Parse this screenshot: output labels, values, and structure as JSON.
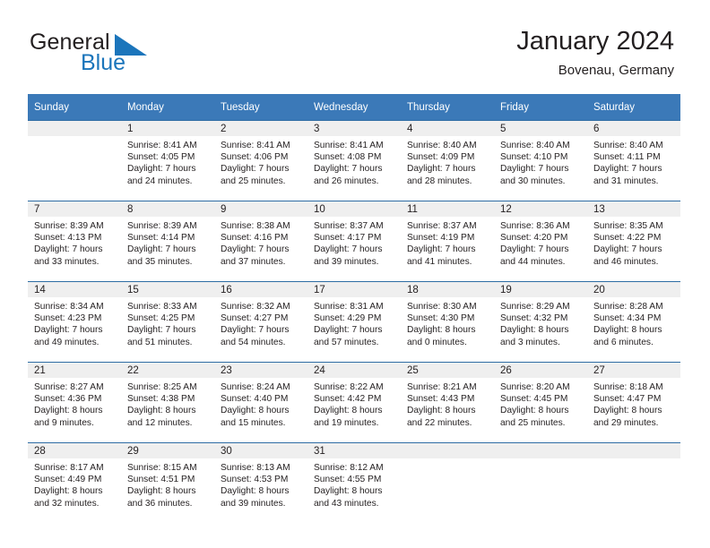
{
  "brand": {
    "name_part1": "General",
    "name_part2": "Blue",
    "mark_icon": "blue-triangle-logo-icon",
    "color_primary": "#1b75bb",
    "color_text": "#231f20"
  },
  "header": {
    "title": "January 2024",
    "subtitle": "Bovenau, Germany"
  },
  "theme": {
    "header_row_bg": "#3b79b8",
    "row_divider": "#2e6da4",
    "daynum_band_bg": "#efefef",
    "cell_bg": "#ffffff"
  },
  "calendar": {
    "weekday_headers": [
      "Sunday",
      "Monday",
      "Tuesday",
      "Wednesday",
      "Thursday",
      "Friday",
      "Saturday"
    ],
    "weeks": [
      [
        {
          "day": "",
          "empty": true,
          "sunrise": "",
          "sunset": "",
          "daylight1": "",
          "daylight2": ""
        },
        {
          "day": "1",
          "sunrise": "Sunrise: 8:41 AM",
          "sunset": "Sunset: 4:05 PM",
          "daylight1": "Daylight: 7 hours",
          "daylight2": "and 24 minutes."
        },
        {
          "day": "2",
          "sunrise": "Sunrise: 8:41 AM",
          "sunset": "Sunset: 4:06 PM",
          "daylight1": "Daylight: 7 hours",
          "daylight2": "and 25 minutes."
        },
        {
          "day": "3",
          "sunrise": "Sunrise: 8:41 AM",
          "sunset": "Sunset: 4:08 PM",
          "daylight1": "Daylight: 7 hours",
          "daylight2": "and 26 minutes."
        },
        {
          "day": "4",
          "sunrise": "Sunrise: 8:40 AM",
          "sunset": "Sunset: 4:09 PM",
          "daylight1": "Daylight: 7 hours",
          "daylight2": "and 28 minutes."
        },
        {
          "day": "5",
          "sunrise": "Sunrise: 8:40 AM",
          "sunset": "Sunset: 4:10 PM",
          "daylight1": "Daylight: 7 hours",
          "daylight2": "and 30 minutes."
        },
        {
          "day": "6",
          "sunrise": "Sunrise: 8:40 AM",
          "sunset": "Sunset: 4:11 PM",
          "daylight1": "Daylight: 7 hours",
          "daylight2": "and 31 minutes."
        }
      ],
      [
        {
          "day": "7",
          "sunrise": "Sunrise: 8:39 AM",
          "sunset": "Sunset: 4:13 PM",
          "daylight1": "Daylight: 7 hours",
          "daylight2": "and 33 minutes."
        },
        {
          "day": "8",
          "sunrise": "Sunrise: 8:39 AM",
          "sunset": "Sunset: 4:14 PM",
          "daylight1": "Daylight: 7 hours",
          "daylight2": "and 35 minutes."
        },
        {
          "day": "9",
          "sunrise": "Sunrise: 8:38 AM",
          "sunset": "Sunset: 4:16 PM",
          "daylight1": "Daylight: 7 hours",
          "daylight2": "and 37 minutes."
        },
        {
          "day": "10",
          "sunrise": "Sunrise: 8:37 AM",
          "sunset": "Sunset: 4:17 PM",
          "daylight1": "Daylight: 7 hours",
          "daylight2": "and 39 minutes."
        },
        {
          "day": "11",
          "sunrise": "Sunrise: 8:37 AM",
          "sunset": "Sunset: 4:19 PM",
          "daylight1": "Daylight: 7 hours",
          "daylight2": "and 41 minutes."
        },
        {
          "day": "12",
          "sunrise": "Sunrise: 8:36 AM",
          "sunset": "Sunset: 4:20 PM",
          "daylight1": "Daylight: 7 hours",
          "daylight2": "and 44 minutes."
        },
        {
          "day": "13",
          "sunrise": "Sunrise: 8:35 AM",
          "sunset": "Sunset: 4:22 PM",
          "daylight1": "Daylight: 7 hours",
          "daylight2": "and 46 minutes."
        }
      ],
      [
        {
          "day": "14",
          "sunrise": "Sunrise: 8:34 AM",
          "sunset": "Sunset: 4:23 PM",
          "daylight1": "Daylight: 7 hours",
          "daylight2": "and 49 minutes."
        },
        {
          "day": "15",
          "sunrise": "Sunrise: 8:33 AM",
          "sunset": "Sunset: 4:25 PM",
          "daylight1": "Daylight: 7 hours",
          "daylight2": "and 51 minutes."
        },
        {
          "day": "16",
          "sunrise": "Sunrise: 8:32 AM",
          "sunset": "Sunset: 4:27 PM",
          "daylight1": "Daylight: 7 hours",
          "daylight2": "and 54 minutes."
        },
        {
          "day": "17",
          "sunrise": "Sunrise: 8:31 AM",
          "sunset": "Sunset: 4:29 PM",
          "daylight1": "Daylight: 7 hours",
          "daylight2": "and 57 minutes."
        },
        {
          "day": "18",
          "sunrise": "Sunrise: 8:30 AM",
          "sunset": "Sunset: 4:30 PM",
          "daylight1": "Daylight: 8 hours",
          "daylight2": "and 0 minutes."
        },
        {
          "day": "19",
          "sunrise": "Sunrise: 8:29 AM",
          "sunset": "Sunset: 4:32 PM",
          "daylight1": "Daylight: 8 hours",
          "daylight2": "and 3 minutes."
        },
        {
          "day": "20",
          "sunrise": "Sunrise: 8:28 AM",
          "sunset": "Sunset: 4:34 PM",
          "daylight1": "Daylight: 8 hours",
          "daylight2": "and 6 minutes."
        }
      ],
      [
        {
          "day": "21",
          "sunrise": "Sunrise: 8:27 AM",
          "sunset": "Sunset: 4:36 PM",
          "daylight1": "Daylight: 8 hours",
          "daylight2": "and 9 minutes."
        },
        {
          "day": "22",
          "sunrise": "Sunrise: 8:25 AM",
          "sunset": "Sunset: 4:38 PM",
          "daylight1": "Daylight: 8 hours",
          "daylight2": "and 12 minutes."
        },
        {
          "day": "23",
          "sunrise": "Sunrise: 8:24 AM",
          "sunset": "Sunset: 4:40 PM",
          "daylight1": "Daylight: 8 hours",
          "daylight2": "and 15 minutes."
        },
        {
          "day": "24",
          "sunrise": "Sunrise: 8:22 AM",
          "sunset": "Sunset: 4:42 PM",
          "daylight1": "Daylight: 8 hours",
          "daylight2": "and 19 minutes."
        },
        {
          "day": "25",
          "sunrise": "Sunrise: 8:21 AM",
          "sunset": "Sunset: 4:43 PM",
          "daylight1": "Daylight: 8 hours",
          "daylight2": "and 22 minutes."
        },
        {
          "day": "26",
          "sunrise": "Sunrise: 8:20 AM",
          "sunset": "Sunset: 4:45 PM",
          "daylight1": "Daylight: 8 hours",
          "daylight2": "and 25 minutes."
        },
        {
          "day": "27",
          "sunrise": "Sunrise: 8:18 AM",
          "sunset": "Sunset: 4:47 PM",
          "daylight1": "Daylight: 8 hours",
          "daylight2": "and 29 minutes."
        }
      ],
      [
        {
          "day": "28",
          "sunrise": "Sunrise: 8:17 AM",
          "sunset": "Sunset: 4:49 PM",
          "daylight1": "Daylight: 8 hours",
          "daylight2": "and 32 minutes."
        },
        {
          "day": "29",
          "sunrise": "Sunrise: 8:15 AM",
          "sunset": "Sunset: 4:51 PM",
          "daylight1": "Daylight: 8 hours",
          "daylight2": "and 36 minutes."
        },
        {
          "day": "30",
          "sunrise": "Sunrise: 8:13 AM",
          "sunset": "Sunset: 4:53 PM",
          "daylight1": "Daylight: 8 hours",
          "daylight2": "and 39 minutes."
        },
        {
          "day": "31",
          "sunrise": "Sunrise: 8:12 AM",
          "sunset": "Sunset: 4:55 PM",
          "daylight1": "Daylight: 8 hours",
          "daylight2": "and 43 minutes."
        },
        {
          "day": "",
          "empty": true,
          "sunrise": "",
          "sunset": "",
          "daylight1": "",
          "daylight2": ""
        },
        {
          "day": "",
          "empty": true,
          "sunrise": "",
          "sunset": "",
          "daylight1": "",
          "daylight2": ""
        },
        {
          "day": "",
          "empty": true,
          "sunrise": "",
          "sunset": "",
          "daylight1": "",
          "daylight2": ""
        }
      ]
    ]
  }
}
